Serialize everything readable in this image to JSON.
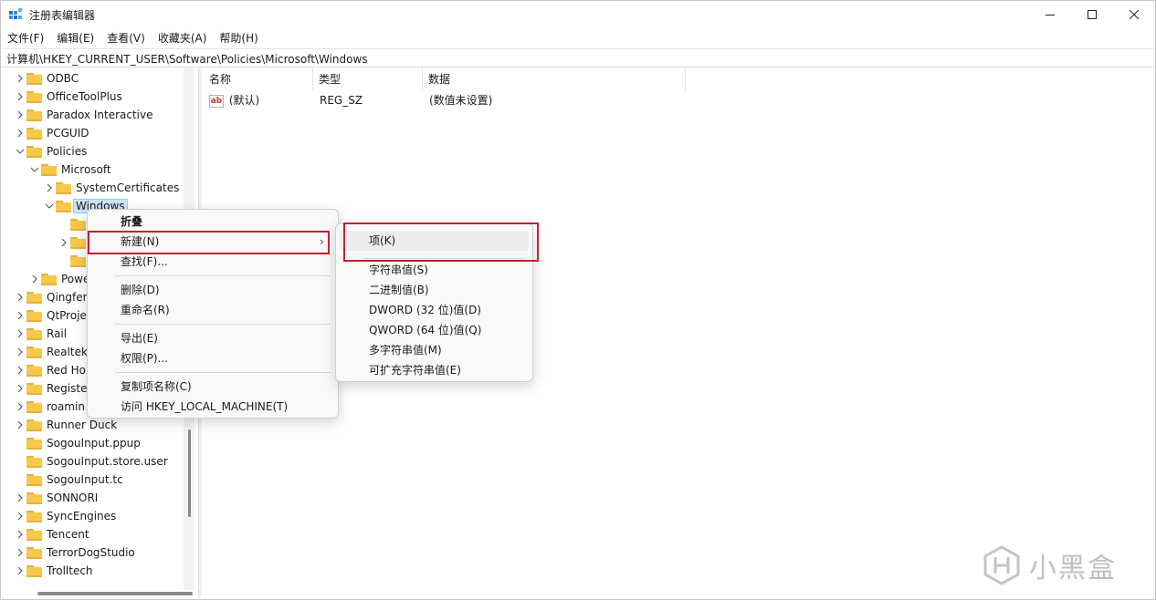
{
  "window": {
    "title": "注册表编辑器"
  },
  "menubar": [
    "文件(F)",
    "编辑(E)",
    "查看(V)",
    "收藏夹(A)",
    "帮助(H)"
  ],
  "address": "计算机\\HKEY_CURRENT_USER\\Software\\Policies\\Microsoft\\Windows",
  "tree": [
    {
      "label": "ODBC",
      "level": 0,
      "arrow": "right"
    },
    {
      "label": "OfficeToolPlus",
      "level": 0,
      "arrow": "right"
    },
    {
      "label": "Paradox Interactive",
      "level": 0,
      "arrow": "right"
    },
    {
      "label": "PCGUID",
      "level": 0,
      "arrow": "right"
    },
    {
      "label": "Policies",
      "level": 0,
      "arrow": "down"
    },
    {
      "label": "Microsoft",
      "level": 1,
      "arrow": "down"
    },
    {
      "label": "SystemCertificates",
      "level": 2,
      "arrow": "right"
    },
    {
      "label": "Windows",
      "level": 2,
      "arrow": "down",
      "selected": true
    },
    {
      "label": "",
      "level": 3,
      "arrow": ""
    },
    {
      "label": "",
      "level": 3,
      "arrow": "right"
    },
    {
      "label": "",
      "level": 3,
      "arrow": ""
    },
    {
      "label": "Powe",
      "level": 1,
      "arrow": "right"
    },
    {
      "label": "Qingfer",
      "level": 0,
      "arrow": "right"
    },
    {
      "label": "QtProje",
      "level": 0,
      "arrow": "right"
    },
    {
      "label": "Rail",
      "level": 0,
      "arrow": "right"
    },
    {
      "label": "Realtek",
      "level": 0,
      "arrow": "right"
    },
    {
      "label": "Red Ho",
      "level": 0,
      "arrow": "right"
    },
    {
      "label": "Registe",
      "level": 0,
      "arrow": "right"
    },
    {
      "label": "roamin",
      "level": 0,
      "arrow": "right"
    },
    {
      "label": "Runner Duck",
      "level": 0,
      "arrow": "right"
    },
    {
      "label": "SogouInput.ppup",
      "level": 0,
      "arrow": ""
    },
    {
      "label": "SogouInput.store.user",
      "level": 0,
      "arrow": ""
    },
    {
      "label": "SogouInput.tc",
      "level": 0,
      "arrow": ""
    },
    {
      "label": "SONNORI",
      "level": 0,
      "arrow": "right"
    },
    {
      "label": "SyncEngines",
      "level": 0,
      "arrow": "right"
    },
    {
      "label": "Tencent",
      "level": 0,
      "arrow": "right"
    },
    {
      "label": "TerrorDogStudio",
      "level": 0,
      "arrow": "right"
    },
    {
      "label": "Trolltech",
      "level": 0,
      "arrow": "right"
    }
  ],
  "list": {
    "columns": [
      "名称",
      "类型",
      "数据"
    ],
    "rows": [
      {
        "icon": "ab",
        "name": "(默认)",
        "type": "REG_SZ",
        "data": "(数值未设置)"
      }
    ]
  },
  "context_menu": {
    "items": [
      "折叠",
      "新建(N)",
      "查找(F)...",
      "删除(D)",
      "重命名(R)",
      "导出(E)",
      "权限(P)...",
      "复制项名称(C)",
      "访问 HKEY_LOCAL_MACHINE(T)"
    ]
  },
  "submenu": {
    "items": [
      "项(K)",
      "字符串值(S)",
      "二进制值(B)",
      "DWORD (32 位)值(D)",
      "QWORD (64 位)值(Q)",
      "多字符串值(M)",
      "可扩充字符串值(E)"
    ]
  },
  "watermark": {
    "text": "小黑盒"
  },
  "colors": {
    "highlight_box": "#c8202f",
    "folder": "#f7c948",
    "selection": "#cce4f7"
  }
}
